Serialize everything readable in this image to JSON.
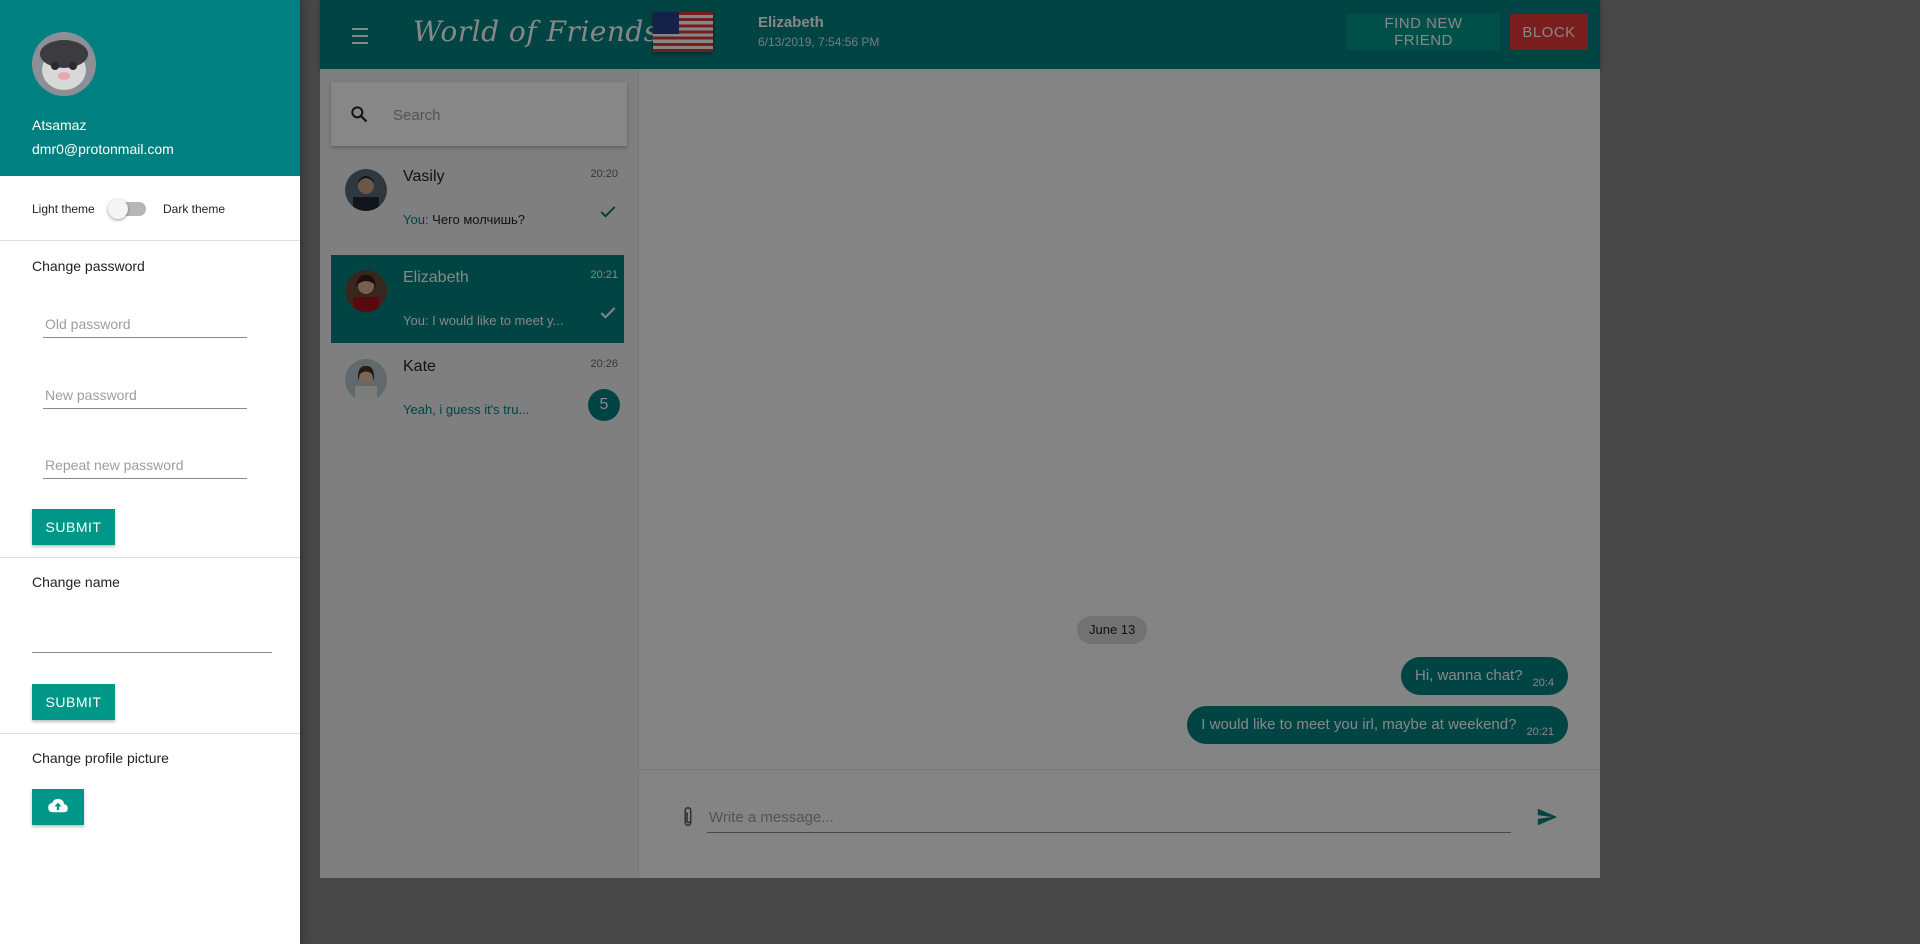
{
  "app": {
    "brand": "World of Friends",
    "colors": {
      "accent": "#008080",
      "accent_button": "#009688",
      "danger": "#e53935",
      "overlay": "rgba(0,0,0,0.47)"
    }
  },
  "header": {
    "contact_name": "Elizabeth",
    "contact_last_seen": "6/13/2019, 7:54:56 PM",
    "find_new_friend_label": "FIND NEW FRIEND",
    "block_label": "BLOCK",
    "flag_icon": "us-flag-icon",
    "menu_icon": "hamburger-menu-icon"
  },
  "search": {
    "placeholder": "Search",
    "icon": "search-icon"
  },
  "chats": [
    {
      "name": "Vasily",
      "time": "20:20",
      "prefix": "You:",
      "text": " Чего молчишь?",
      "status": "read"
    },
    {
      "name": "Elizabeth",
      "time": "20:21",
      "prefix": "You:",
      "text": " I would like to meet y...",
      "status": "read",
      "active": true
    },
    {
      "name": "Kate",
      "time": "20:26",
      "text": "Yeah, i guess it's tru...",
      "unread": "5"
    }
  ],
  "conversation": {
    "date_chip": "June 13",
    "messages": [
      {
        "text": "Hi, wanna chat?",
        "time": "20:4"
      },
      {
        "text": "I would like to meet you irl, maybe at weekend?",
        "time": "20:21"
      }
    ],
    "composer_placeholder": "Write a message...",
    "attach_icon": "paperclip-icon",
    "send_icon": "send-icon"
  },
  "drawer": {
    "user_name": "Atsamaz",
    "user_email": "dmr0@protonmail.com",
    "theme": {
      "light_label": "Light theme",
      "dark_label": "Dark theme",
      "dark_enabled": false
    },
    "change_password": {
      "title": "Change password",
      "old_placeholder": "Old password",
      "new_placeholder": "New password",
      "repeat_placeholder": "Repeat new password",
      "submit_label": "SUBMIT"
    },
    "change_name": {
      "title": "Change name",
      "value": "",
      "submit_label": "SUBMIT"
    },
    "change_picture": {
      "title": "Change profile picture",
      "icon": "cloud-upload-icon"
    }
  }
}
